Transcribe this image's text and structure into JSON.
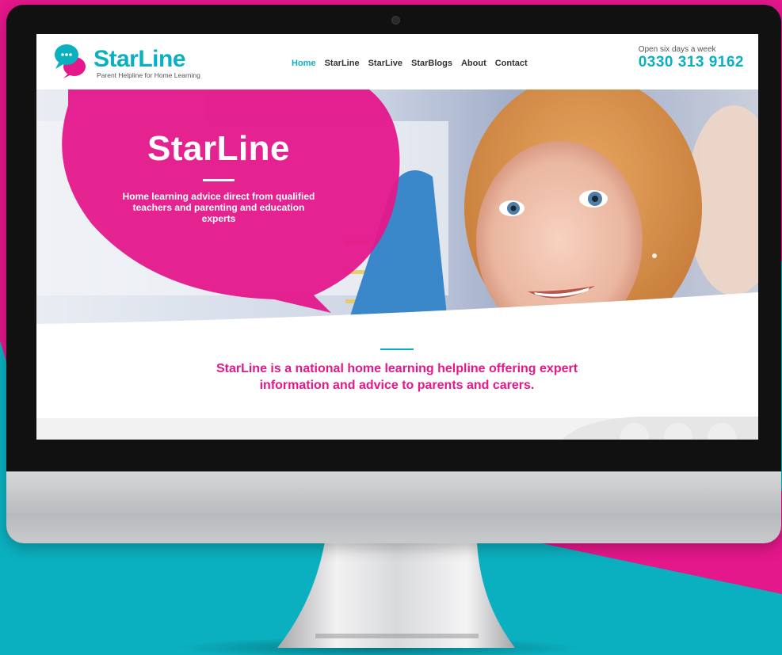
{
  "colors": {
    "teal": "#0bb0c0",
    "pink": "#e4178b",
    "bezel": "#111111",
    "aluminium": "#c6c7c9"
  },
  "site": {
    "logo": {
      "icon": "speech-bubbles-icon",
      "name": "StarLine",
      "tagline": "Parent Helpline for Home Learning"
    },
    "nav": [
      {
        "label": "Home",
        "active": true
      },
      {
        "label": "StarLine",
        "active": false
      },
      {
        "label": "StarLive",
        "active": false
      },
      {
        "label": "StarBlogs",
        "active": false
      },
      {
        "label": "About",
        "active": false
      },
      {
        "label": "Contact",
        "active": false
      }
    ],
    "contact": {
      "note": "Open six days a week",
      "phone": "0330 313 9162"
    },
    "hero": {
      "title": "StarLine",
      "subtitle": "Home learning advice direct from qualified teachers and parenting and education experts",
      "image": "girl-at-whiteboard-photo"
    },
    "intro": "StarLine is a national home learning helpline offering expert information and advice to parents and carers."
  }
}
